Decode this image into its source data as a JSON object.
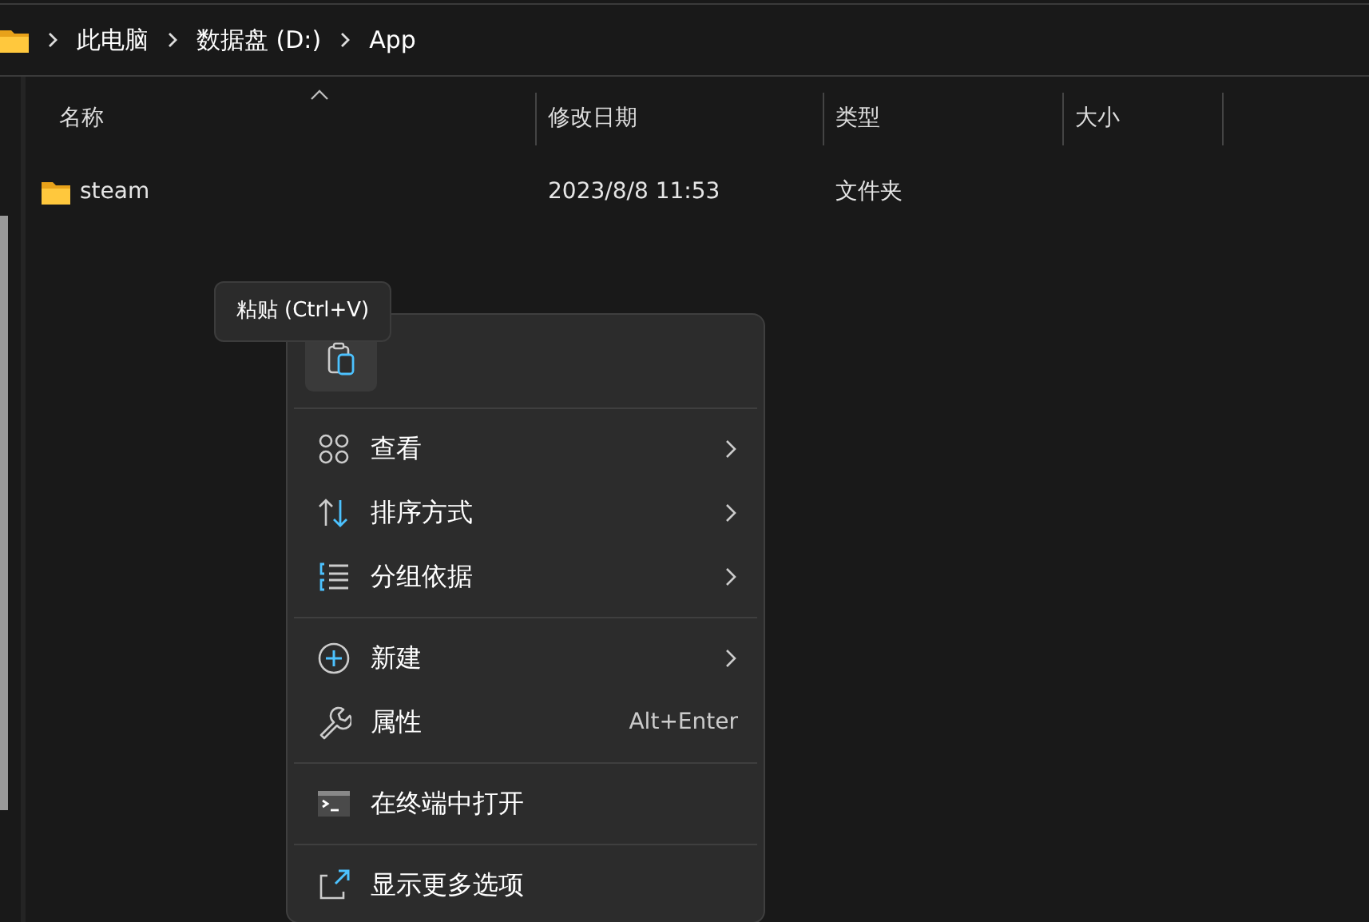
{
  "breadcrumb": [
    {
      "label": "此电脑"
    },
    {
      "label": "数据盘 (D:)"
    },
    {
      "label": "App"
    }
  ],
  "columns": [
    {
      "label": "名称",
      "sorted": true
    },
    {
      "label": "修改日期",
      "sorted": false
    },
    {
      "label": "类型",
      "sorted": false
    },
    {
      "label": "大小",
      "sorted": false
    }
  ],
  "rows": [
    {
      "name": "steam",
      "modified": "2023/8/8 11:53",
      "type": "文件夹"
    }
  ],
  "tooltip": {
    "text": "粘贴 (Ctrl+V)"
  },
  "context_menu": {
    "top_actions": [
      {
        "kind": "paste",
        "hovered": true
      }
    ],
    "groups": [
      [
        {
          "kind": "view",
          "label": "查看",
          "submenu": true
        },
        {
          "kind": "sort",
          "label": "排序方式",
          "submenu": true
        },
        {
          "kind": "group",
          "label": "分组依据",
          "submenu": true
        }
      ],
      [
        {
          "kind": "new",
          "label": "新建",
          "submenu": true
        },
        {
          "kind": "properties",
          "label": "属性",
          "submenu": false,
          "shortcut": "Alt+Enter"
        }
      ],
      [
        {
          "kind": "terminal",
          "label": "在终端中打开",
          "submenu": false
        }
      ],
      [
        {
          "kind": "more",
          "label": "显示更多选项",
          "submenu": false
        }
      ]
    ]
  }
}
